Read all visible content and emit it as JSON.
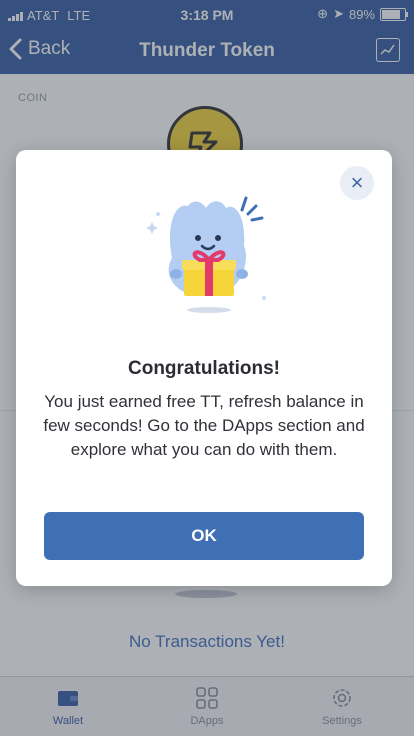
{
  "status_bar": {
    "carrier": "AT&T",
    "network": "LTE",
    "time": "3:18 PM",
    "battery": "89%",
    "battery_level": 0.89
  },
  "nav": {
    "back_label": "Back",
    "title": "Thunder Token"
  },
  "content": {
    "coin_label": "COIN",
    "empty_message": "No Transactions Yet!"
  },
  "modal": {
    "title": "Congratulations!",
    "body": "You just earned free TT, refresh balance in few seconds! Go to the DApps section and explore what you can do with them.",
    "ok_label": "OK",
    "close_icon": "×"
  },
  "tabs": [
    {
      "label": "Wallet",
      "icon": "wallet-icon",
      "active": true
    },
    {
      "label": "DApps",
      "icon": "apps-grid-icon",
      "active": false
    },
    {
      "label": "Settings",
      "icon": "gear-icon",
      "active": false
    }
  ],
  "colors": {
    "brand_blue": "#3f66a8",
    "button_blue": "#3f6fb5",
    "coin_yellow": "#f2d544",
    "gift_pink": "#e23a6d",
    "gift_yellow": "#f6d53b",
    "mascot_blue": "#b3cdf3"
  }
}
